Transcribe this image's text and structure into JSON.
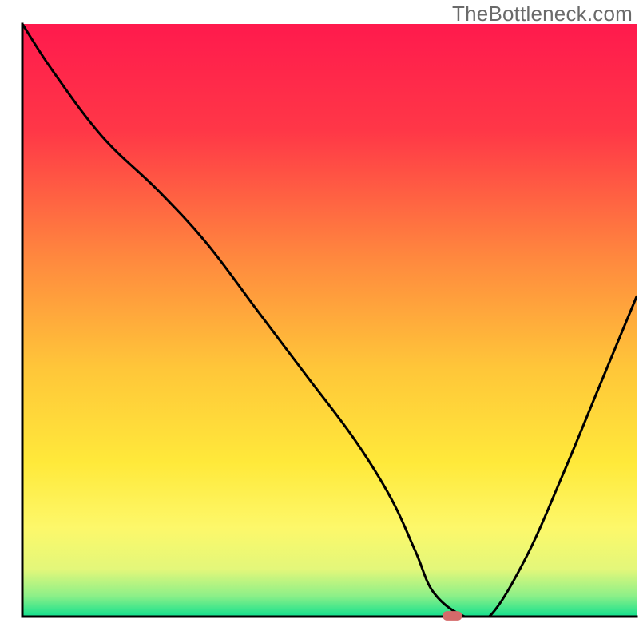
{
  "watermark": "TheBottleneck.com",
  "chart_data": {
    "type": "line",
    "title": "",
    "xlabel": "",
    "ylabel": "",
    "xlim": [
      0,
      100
    ],
    "ylim": [
      0,
      100
    ],
    "background_gradient": {
      "stops": [
        {
          "offset": 0,
          "color": "#ff1a4d"
        },
        {
          "offset": 18,
          "color": "#ff3747"
        },
        {
          "offset": 40,
          "color": "#ff8a3e"
        },
        {
          "offset": 58,
          "color": "#ffc639"
        },
        {
          "offset": 74,
          "color": "#ffe93a"
        },
        {
          "offset": 85,
          "color": "#fdf86a"
        },
        {
          "offset": 92,
          "color": "#e3f77a"
        },
        {
          "offset": 96.5,
          "color": "#8df088"
        },
        {
          "offset": 100,
          "color": "#12e08e"
        }
      ]
    },
    "series": [
      {
        "name": "bottleneck-curve",
        "x": [
          0,
          5,
          13,
          22,
          30,
          38,
          46,
          54,
          60,
          64,
          67,
          72,
          76,
          82,
          88,
          94,
          100
        ],
        "values": [
          100,
          92,
          81,
          72,
          63,
          52,
          41,
          30,
          20,
          11,
          4,
          0,
          0,
          10,
          24,
          39,
          54
        ]
      }
    ],
    "marker": {
      "name": "sweet-spot-marker",
      "x": 70,
      "y": 0,
      "color": "#d46a6a",
      "width_pct": 3.2,
      "height_pct": 1.6
    },
    "axes_color": "#000000",
    "axes_width": 3
  }
}
